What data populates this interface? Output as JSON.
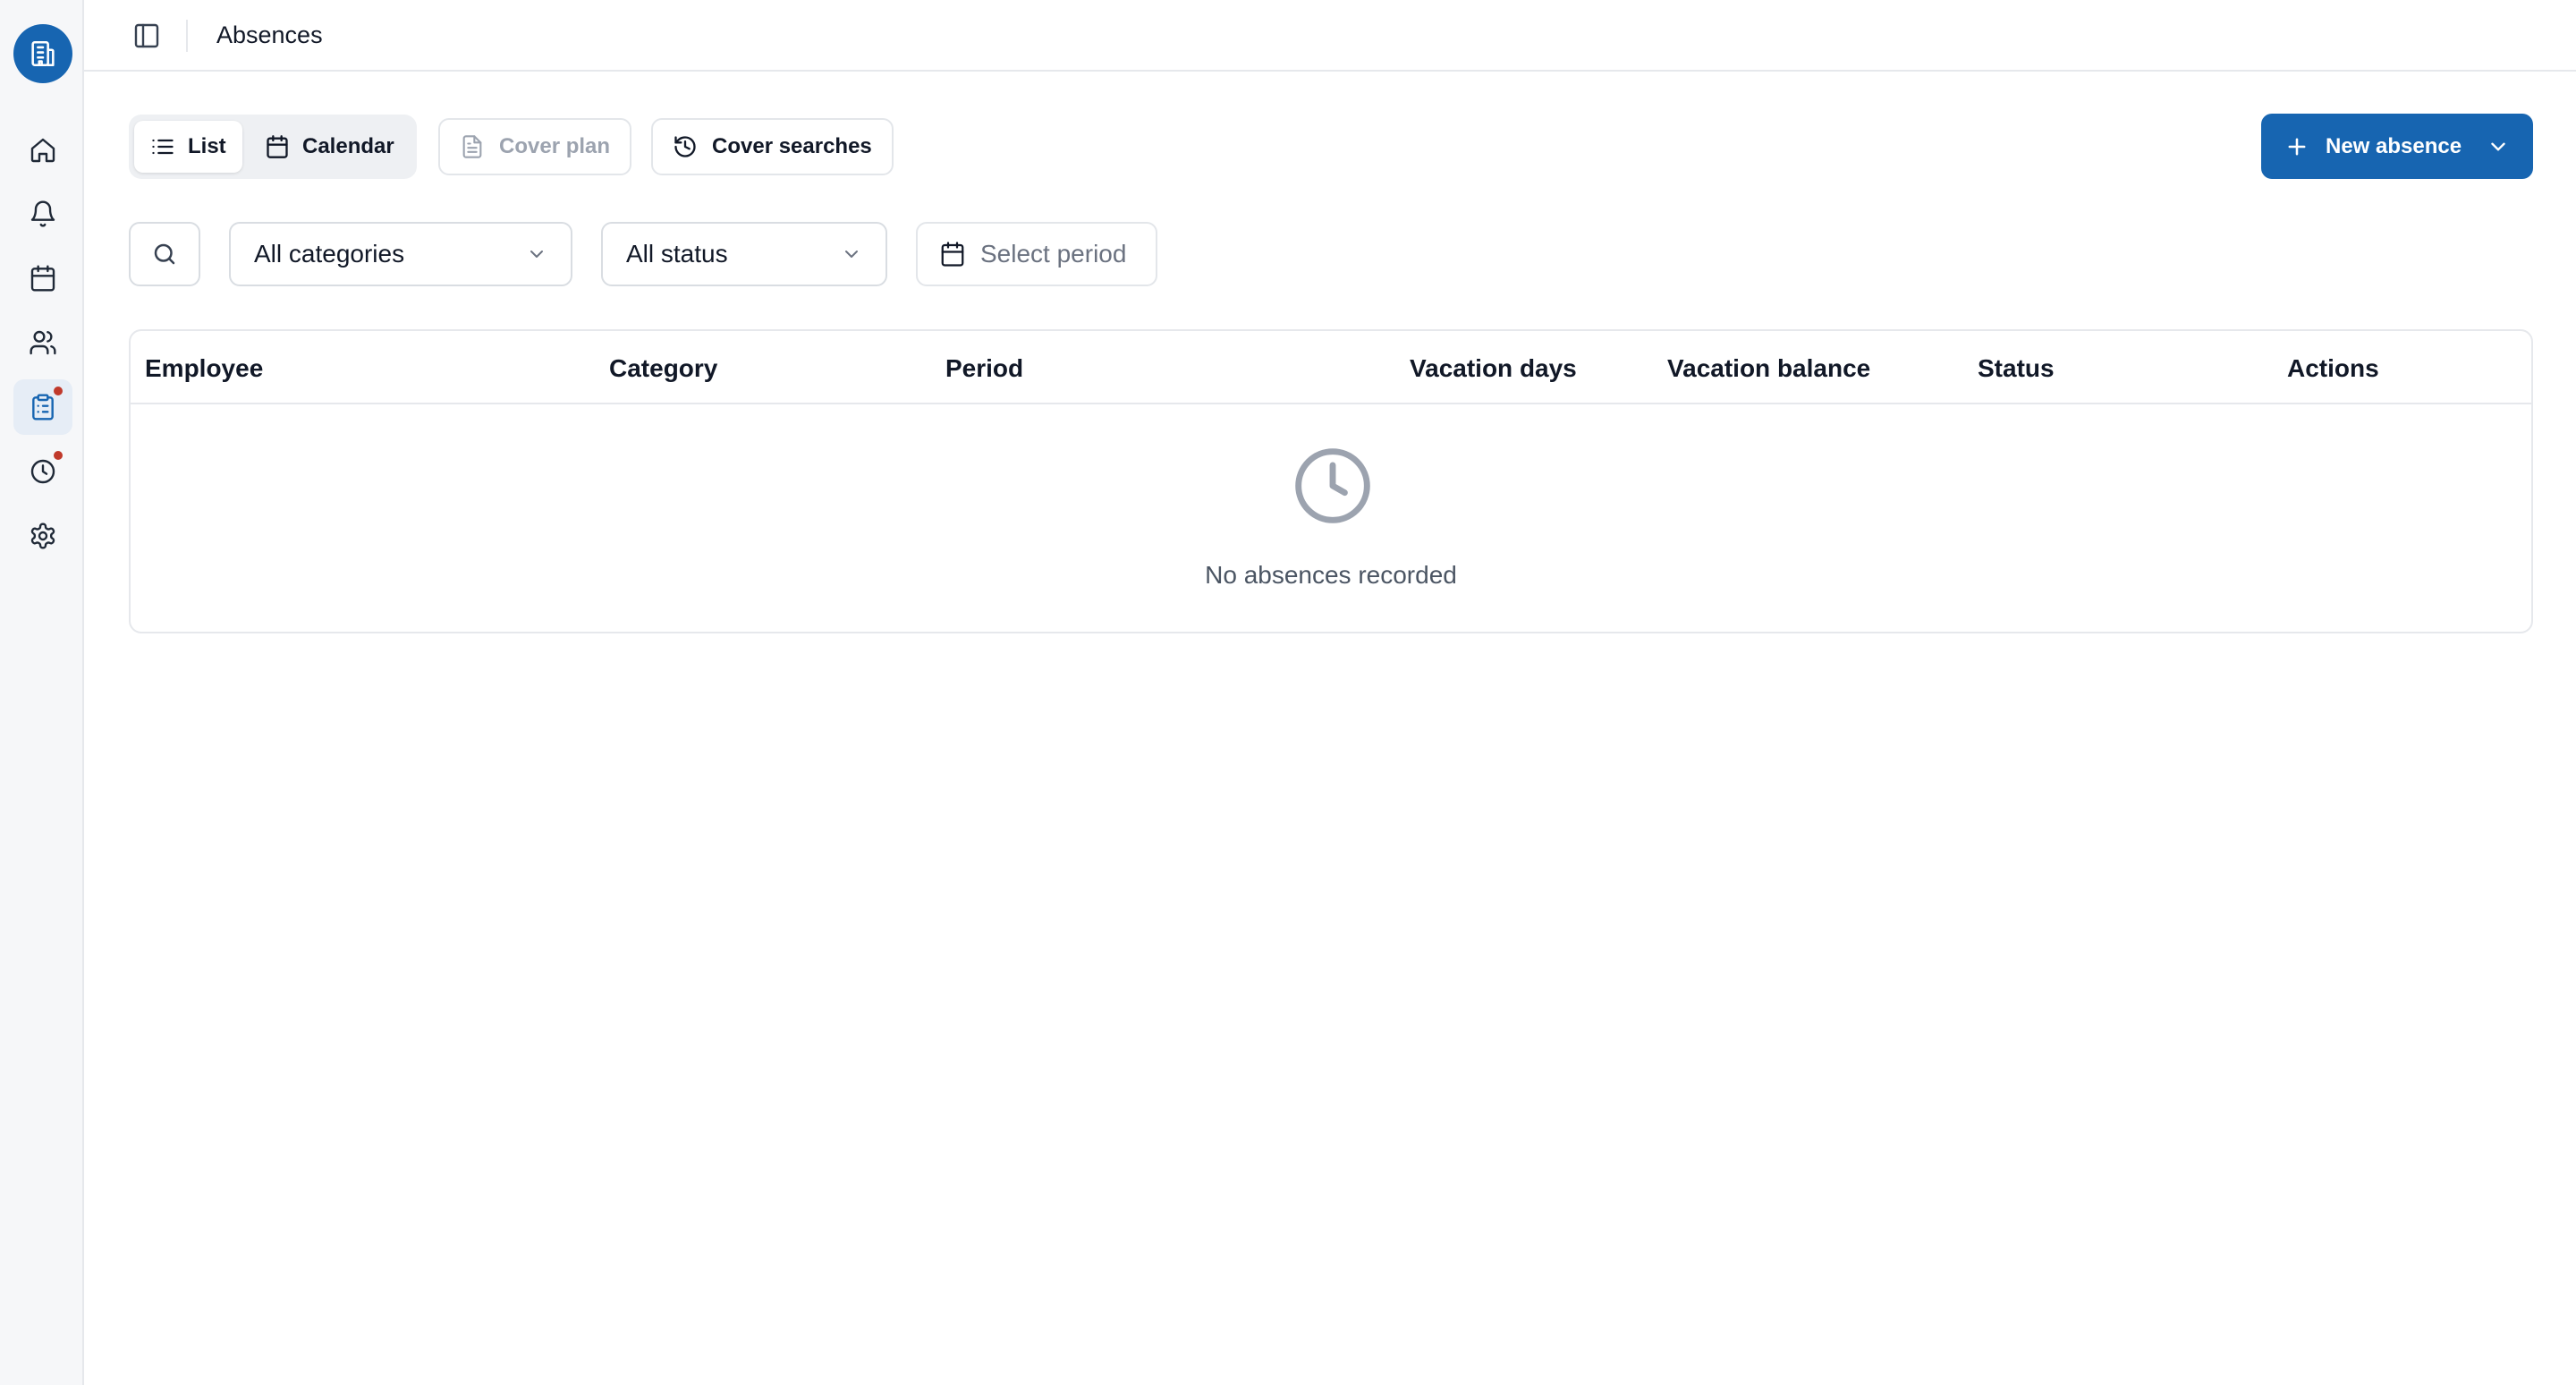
{
  "header": {
    "title": "Absences"
  },
  "sidebar": {
    "items": [
      {
        "name": "home",
        "active": false,
        "badge": false
      },
      {
        "name": "notifications",
        "active": false,
        "badge": false
      },
      {
        "name": "calendar",
        "active": false,
        "badge": false
      },
      {
        "name": "employees",
        "active": false,
        "badge": true
      },
      {
        "name": "absences",
        "active": true,
        "badge": true
      },
      {
        "name": "time-tracking",
        "active": false,
        "badge": true
      },
      {
        "name": "settings",
        "active": false,
        "badge": false
      }
    ]
  },
  "view_tabs": {
    "list": "List",
    "calendar": "Calendar",
    "active": "List"
  },
  "actions": {
    "cover_plan": "Cover plan",
    "cover_searches": "Cover searches",
    "new_absence": "New absence"
  },
  "filters": {
    "category": "All categories",
    "status": "All status",
    "period_placeholder": "Select period"
  },
  "table": {
    "columns": [
      "Employee",
      "Category",
      "Period",
      "Vacation days",
      "Vacation balance",
      "Status",
      "Actions"
    ],
    "rows": [],
    "empty_message": "No absences recorded"
  },
  "colors": {
    "primary": "#1765b1",
    "badge": "#c0392b",
    "sidebar_bg": "#f6f7f9",
    "border": "#e6e8ec"
  }
}
